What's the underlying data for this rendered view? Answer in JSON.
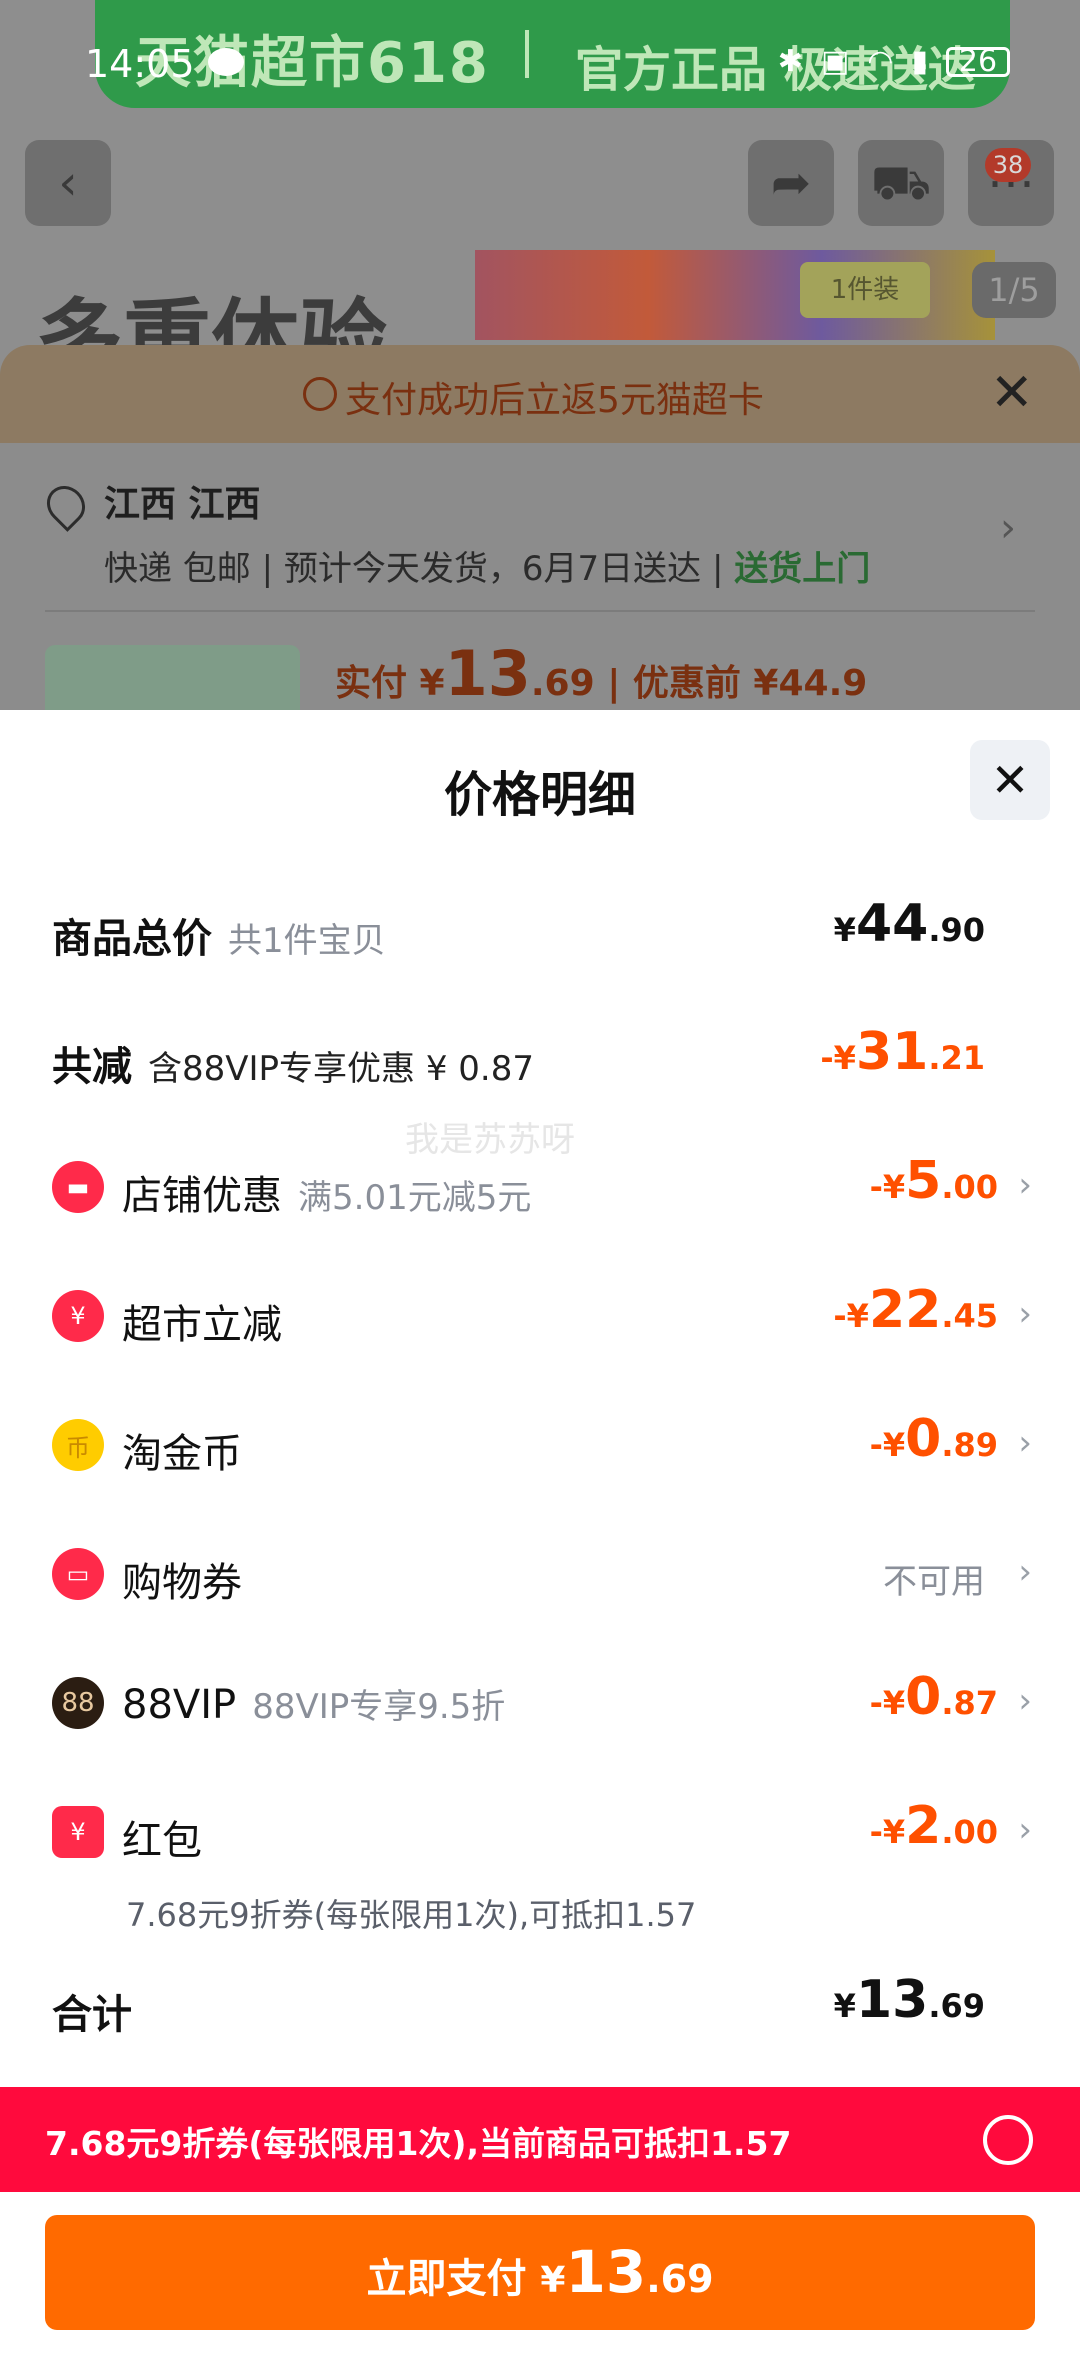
{
  "status_bar": {
    "time": "14:05",
    "battery": "26"
  },
  "background": {
    "banner_left": "天猫超市618",
    "banner_right": "官方正品 极速送达",
    "cart_badge": "38",
    "product_title_partial": "多重体验",
    "pack_tag": "1件装",
    "image_index": "1/5",
    "cashback_text": "支付成功后立返5元猫超卡",
    "address_name": "江西 江西",
    "delivery_text": "快递 包邮 | 预计今天发货，6月7日送达 | ",
    "delivery_highlight": "送货上门",
    "paid_label": "实付 ¥",
    "paid_int": "13",
    "paid_dec": ".69",
    "before_label": "| 优惠前 ¥44.9"
  },
  "sheet": {
    "title": "价格明细",
    "rows": {
      "total": {
        "label": "商品总价",
        "sub": "共1件宝贝",
        "cur": "¥",
        "int": "44",
        "dec": ".90"
      },
      "reduce": {
        "label": "共减",
        "sub": "含88VIP专享优惠 ¥ 0.87",
        "cur": "-¥",
        "int": "31",
        "dec": ".21"
      },
      "store": {
        "label": "店铺优惠",
        "sub": "满5.01元减5元",
        "cur": "-¥",
        "int": "5",
        "dec": ".00",
        "icon": "store-coupon-icon"
      },
      "market": {
        "label": "超市立减",
        "sub": "",
        "cur": "-¥",
        "int": "22",
        "dec": ".45",
        "icon": "yuan-discount-icon"
      },
      "coins": {
        "label": "淘金币",
        "sub": "",
        "cur": "-¥",
        "int": "0",
        "dec": ".89",
        "icon": "gold-coin-icon"
      },
      "voucher": {
        "label": "购物券",
        "sub": "",
        "status": "不可用",
        "icon": "ticket-icon"
      },
      "vip": {
        "label": "88VIP",
        "sub": "88VIP专享9.5折",
        "cur": "-¥",
        "int": "0",
        "dec": ".87",
        "icon": "vip-88-icon"
      },
      "redpacket": {
        "label": "红包",
        "detail": "7.68元9折券(每张限用1次),可抵扣1.57",
        "cur": "-¥",
        "int": "2",
        "dec": ".00",
        "icon": "red-packet-icon"
      },
      "sum": {
        "label": "合计",
        "cur": "¥",
        "int": "13",
        "dec": ".69"
      }
    },
    "watermark": "我是苏苏呀",
    "coupon_bar": "7.68元9折券(每张限用1次),当前商品可抵扣1.57",
    "pay_button": {
      "label": "立即支付 ",
      "cur": "¥",
      "int": "13",
      "dec": ".69"
    }
  },
  "colors": {
    "accent": "#ff5000",
    "pay": "#ff6a00",
    "coupon_bar": "#ff0a3d"
  }
}
